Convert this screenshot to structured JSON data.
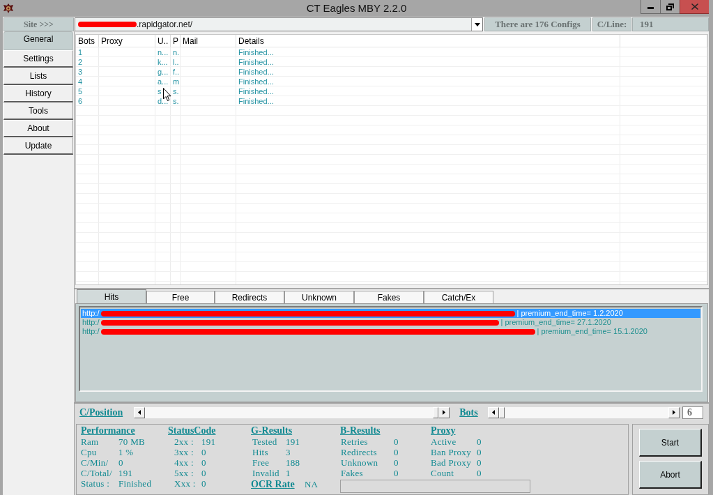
{
  "window": {
    "title": "CT Eagles MBY 2.2.0"
  },
  "top_bar": {
    "site_label": "Site >>>",
    "site_url": ".rapidgator.net/",
    "configs_info": "There are 176 Configs",
    "cline_label": "C/Line:",
    "cline_value": "191"
  },
  "sidebar": {
    "items": [
      {
        "label": "General",
        "selected": true
      },
      {
        "label": "Settings",
        "selected": false
      },
      {
        "label": "Lists",
        "selected": false
      },
      {
        "label": "History",
        "selected": false
      },
      {
        "label": "Tools",
        "selected": false
      },
      {
        "label": "About",
        "selected": false
      },
      {
        "label": "Update",
        "selected": false
      }
    ]
  },
  "bots_table": {
    "columns": [
      "Bots",
      "Proxy",
      "U..",
      "P",
      "Mail",
      "Details"
    ],
    "rows": [
      {
        "bots": "1",
        "column_3": "n...",
        "column_4": "n.",
        "details": "Finished..."
      },
      {
        "bots": "2",
        "column_3": "k...",
        "column_4": "l..",
        "details": "Finished..."
      },
      {
        "bots": "3",
        "column_3": "g...",
        "column_4": "f..",
        "details": "Finished..."
      },
      {
        "bots": "4",
        "column_3": "a...",
        "column_4": "m",
        "details": "Finished..."
      },
      {
        "bots": "5",
        "column_3": "s",
        "column_4": "s.",
        "details": "Finished..."
      },
      {
        "bots": "6",
        "column_3": "d...",
        "column_4": "s.",
        "details": "Finished..."
      }
    ]
  },
  "result_tabs": [
    {
      "label": "Hits",
      "selected": true
    },
    {
      "label": "Free",
      "selected": false
    },
    {
      "label": "Redirects",
      "selected": false
    },
    {
      "label": "Unknown",
      "selected": false
    },
    {
      "label": "Fakes",
      "selected": false
    },
    {
      "label": "Catch/Ex",
      "selected": false
    }
  ],
  "hits_list": {
    "rows": [
      {
        "url_start": "http:/",
        "info": "| premium_end_time= 1.2.2020",
        "selected": true
      },
      {
        "url_start": "http:/",
        "info": "| premium_end_time= 27.1.2020",
        "selected": false
      },
      {
        "url_start": "http:/",
        "info": "| premium_end_time= 15.1.2020",
        "selected": false
      }
    ]
  },
  "scroll_controls": {
    "position_label": "C/Position",
    "bots_label": "Bots",
    "bots_value": "6"
  },
  "stats": {
    "performance": {
      "title": "Performance",
      "rows": [
        {
          "label": "Ram",
          "value": "70 MB"
        },
        {
          "label": "Cpu",
          "value": "1 %"
        },
        {
          "label": "C/Min/",
          "value": "0"
        },
        {
          "label": "C/Total/",
          "value": "191"
        },
        {
          "label": "Status :",
          "value": "Finished"
        }
      ]
    },
    "status_code": {
      "title": "StatusCode",
      "rows": [
        {
          "label": "2xx :",
          "value": "191"
        },
        {
          "label": "3xx :",
          "value": "0"
        },
        {
          "label": "4xx :",
          "value": "0"
        },
        {
          "label": "5xx :",
          "value": "0"
        },
        {
          "label": "Xxx :",
          "value": "0"
        }
      ]
    },
    "g_results": {
      "title": "G-Results",
      "rows": [
        {
          "label": "Tested",
          "value": "191"
        },
        {
          "label": "Hits",
          "value": "3"
        },
        {
          "label": "Free",
          "value": "188"
        },
        {
          "label": "Invalid",
          "value": "1"
        }
      ]
    },
    "ocr_rate": {
      "label": "OCR Rate",
      "value": "NA"
    },
    "b_results": {
      "title": "B-Results",
      "rows": [
        {
          "label": "Retries",
          "value": "0"
        },
        {
          "label": "Redirects",
          "value": "0"
        },
        {
          "label": "Unknown",
          "value": "0"
        },
        {
          "label": "Fakes",
          "value": "0"
        }
      ]
    },
    "proxy": {
      "title": "Proxy",
      "rows": [
        {
          "label": "Active",
          "value": "0"
        },
        {
          "label": "Ban Proxy",
          "value": "0"
        },
        {
          "label": "Bad Proxy",
          "value": "0"
        },
        {
          "label": "Count",
          "value": "0"
        }
      ]
    }
  },
  "buttons": [
    "Start",
    "Abort"
  ]
}
